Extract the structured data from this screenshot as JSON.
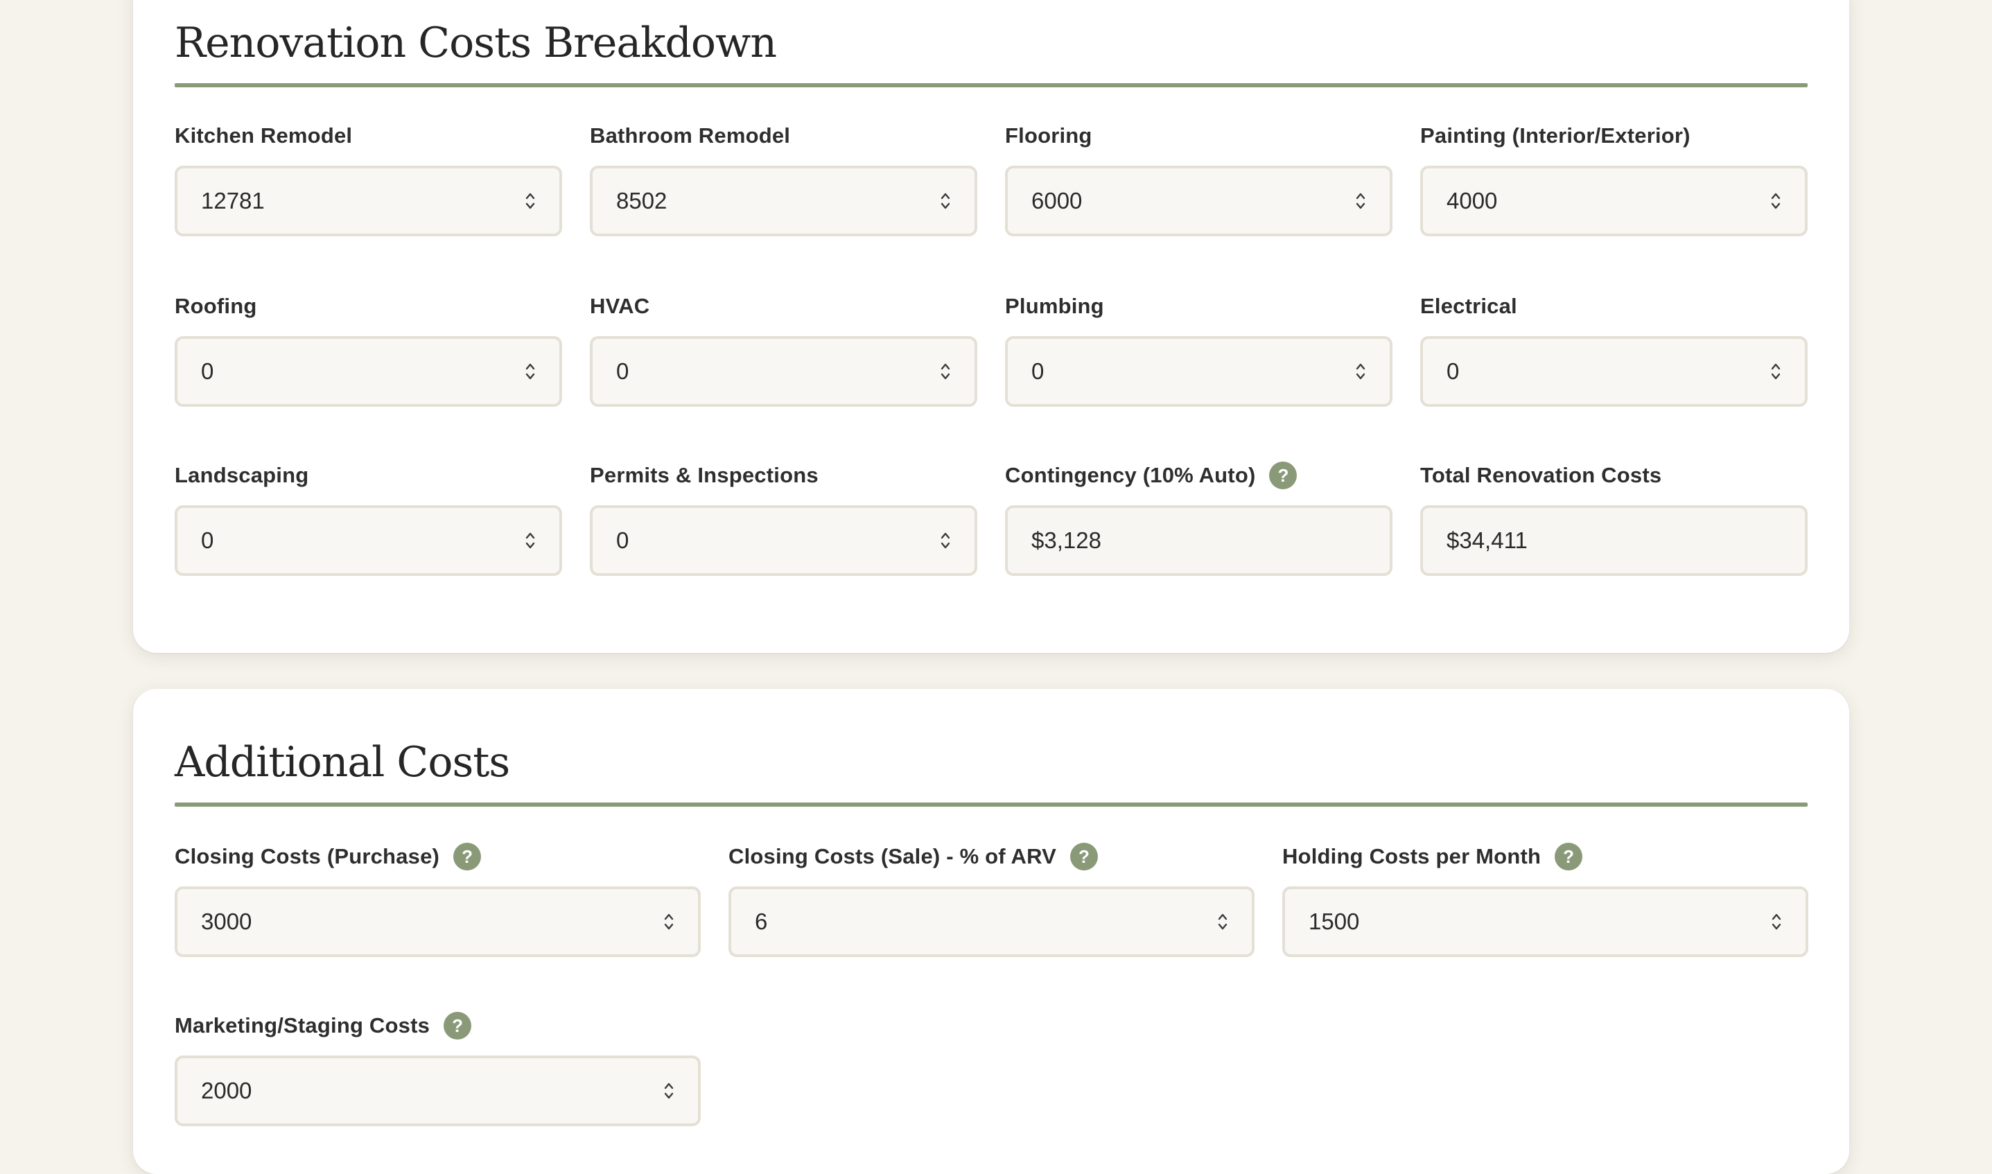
{
  "renovation": {
    "title": "Renovation Costs Breakdown",
    "fields": [
      {
        "label": "Kitchen Remodel",
        "value": "12781",
        "type": "number",
        "help": false
      },
      {
        "label": "Bathroom Remodel",
        "value": "8502",
        "type": "number",
        "help": false
      },
      {
        "label": "Flooring",
        "value": "6000",
        "type": "number",
        "help": false
      },
      {
        "label": "Painting (Interior/Exterior)",
        "value": "4000",
        "type": "number",
        "help": false
      },
      {
        "label": "Roofing",
        "value": "0",
        "type": "number",
        "help": false
      },
      {
        "label": "HVAC",
        "value": "0",
        "type": "number",
        "help": false
      },
      {
        "label": "Plumbing",
        "value": "0",
        "type": "number",
        "help": false
      },
      {
        "label": "Electrical",
        "value": "0",
        "type": "number",
        "help": false
      },
      {
        "label": "Landscaping",
        "value": "0",
        "type": "number",
        "help": false
      },
      {
        "label": "Permits & Inspections",
        "value": "0",
        "type": "number",
        "help": false
      },
      {
        "label": "Contingency (10% Auto)",
        "value": "$3,128",
        "type": "readonly",
        "help": true
      },
      {
        "label": "Total Renovation Costs",
        "value": "$34,411",
        "type": "readonly",
        "help": false
      }
    ]
  },
  "additional": {
    "title": "Additional Costs",
    "fields": [
      {
        "label": "Closing Costs (Purchase)",
        "value": "3000",
        "type": "number",
        "help": true
      },
      {
        "label": "Closing Costs (Sale) - % of ARV",
        "value": "6",
        "type": "number",
        "help": true
      },
      {
        "label": "Holding Costs per Month",
        "value": "1500",
        "type": "number",
        "help": true
      },
      {
        "label": "Marketing/Staging Costs",
        "value": "2000",
        "type": "number",
        "help": true
      }
    ]
  },
  "help_icon_glyph": "?",
  "colors": {
    "page_background": "#f6f3ec",
    "card_background": "#ffffff",
    "accent": "#8a9a78",
    "input_background": "#f8f7f3",
    "input_border": "#e4e0d6"
  }
}
